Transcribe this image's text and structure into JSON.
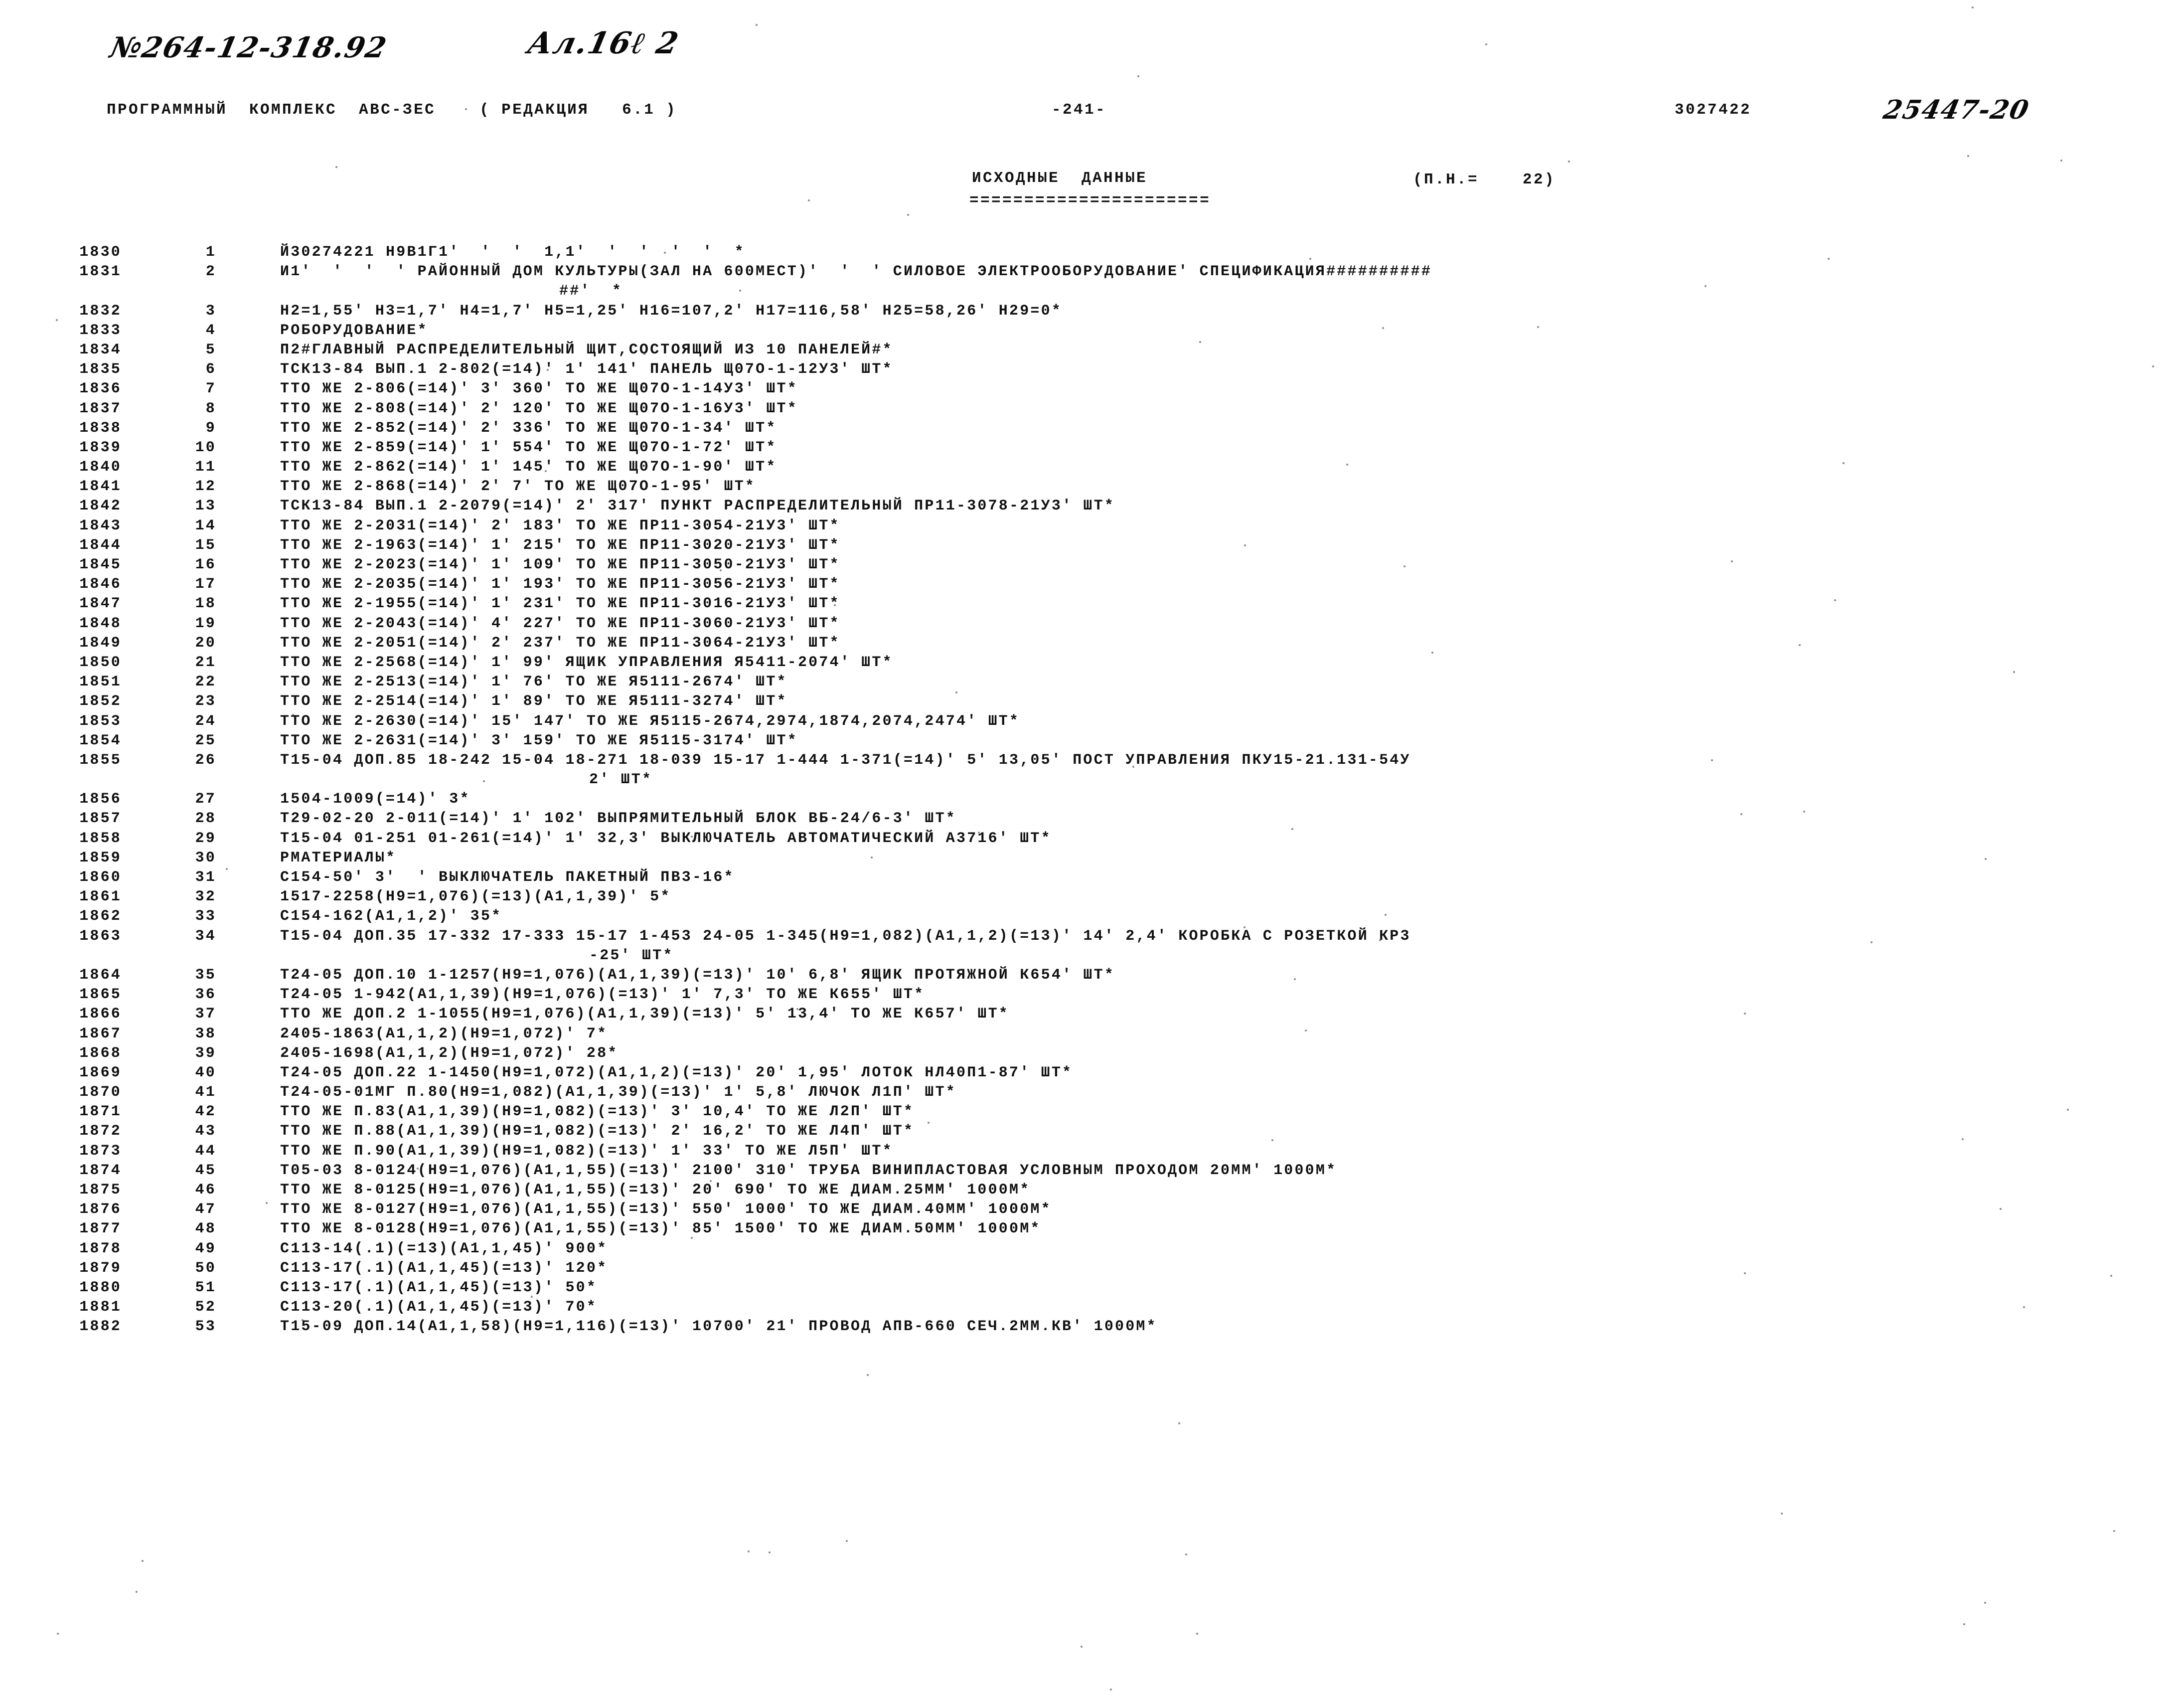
{
  "annotations": {
    "doc_code": "№264-12-318.92",
    "album": "Ал.16ℓ 2",
    "right_number": "25447-20"
  },
  "header": {
    "program_line": "ПРОГРАММНЫЙ  КОМПЛЕКС  АВС-ЗЕС    ( РЕДАКЦИЯ   6.1 )",
    "page_number": "-241-",
    "document_number": "3027422"
  },
  "title": {
    "main": "ИСХОДНЫЕ  ДАННЫЕ",
    "rule": "======================",
    "param": "(П.Н.=    22)"
  },
  "listing": [
    {
      "line": "1830",
      "seq": "1",
      "text": "Й30274221 Н9В1Г1'  '  '  1,1'  '  '  '  '  *"
    },
    {
      "line": "1831",
      "seq": "2",
      "text": "И1'  '  '  ' РАЙОННЫЙ ДОМ КУЛЬТУРЫ(ЗАЛ НА 600МЕСТ)'  '  ' СИЛОВОЕ ЭЛЕКТРООБОРУДОВАНИЕ' СПЕЦИФИКАЦИЯ##########"
    },
    {
      "line": "",
      "seq": "",
      "text": "##'  *",
      "cont": true,
      "indent": 560
    },
    {
      "line": "1832",
      "seq": "3",
      "text": "Н2=1,55' Н3=1,7' Н4=1,7' Н5=1,25' Н16=107,2' Н17=116,58' Н25=58,26' Н29=0*"
    },
    {
      "line": "1833",
      "seq": "4",
      "text": "РОБОРУДОВАНИЕ*"
    },
    {
      "line": "1834",
      "seq": "5",
      "text": "П2#ГЛАВНЫЙ РАСПРЕДЕЛИТЕЛЬНЫЙ ЩИТ,СОСТОЯЩИЙ ИЗ 10 ПАНЕЛЕЙ#*"
    },
    {
      "line": "1835",
      "seq": "6",
      "text": "ТСК13-84 ВЫП.1 2-802(=14)' 1' 141' ПАНЕЛЬ Щ07О-1-12У3' ШТ*"
    },
    {
      "line": "1836",
      "seq": "7",
      "text": "ТТО ЖЕ 2-806(=14)' 3' 360' ТО ЖЕ Щ07О-1-14У3' ШТ*"
    },
    {
      "line": "1837",
      "seq": "8",
      "text": "ТТО ЖЕ 2-808(=14)' 2' 120' ТО ЖЕ Щ07О-1-16У3' ШТ*"
    },
    {
      "line": "1838",
      "seq": "9",
      "text": "ТТО ЖЕ 2-852(=14)' 2' 336' ТО ЖЕ Щ07О-1-34' ШТ*"
    },
    {
      "line": "1839",
      "seq": "10",
      "text": "ТТО ЖЕ 2-859(=14)' 1' 554' ТО ЖЕ Щ07О-1-72' ШТ*"
    },
    {
      "line": "1840",
      "seq": "11",
      "text": "ТТО ЖЕ 2-862(=14)' 1' 145' ТО ЖЕ Щ07О-1-90' ШТ*"
    },
    {
      "line": "1841",
      "seq": "12",
      "text": "ТТО ЖЕ 2-868(=14)' 2' 7' ТО ЖЕ Щ07О-1-95' ШТ*"
    },
    {
      "line": "1842",
      "seq": "13",
      "text": "ТСК13-84 ВЫП.1 2-2079(=14)' 2' 317' ПУНКТ РАСПРЕДЕЛИТЕЛЬНЫЙ ПР11-3078-21У3' ШТ*"
    },
    {
      "line": "1843",
      "seq": "14",
      "text": "ТТО ЖЕ 2-2031(=14)' 2' 183' ТО ЖЕ ПР11-3054-21У3' ШТ*"
    },
    {
      "line": "1844",
      "seq": "15",
      "text": "ТТО ЖЕ 2-1963(=14)' 1' 215' ТО ЖЕ ПР11-3020-21У3' ШТ*"
    },
    {
      "line": "1845",
      "seq": "16",
      "text": "ТТО ЖЕ 2-2023(=14)' 1' 109' ТО ЖЕ ПР11-3050-21У3' ШТ*"
    },
    {
      "line": "1846",
      "seq": "17",
      "text": "ТТО ЖЕ 2-2035(=14)' 1' 193' ТО ЖЕ ПР11-3056-21У3' ШТ*"
    },
    {
      "line": "1847",
      "seq": "18",
      "text": "ТТО ЖЕ 2-1955(=14)' 1' 231' ТО ЖЕ ПР11-3016-21У3' ШТ*"
    },
    {
      "line": "1848",
      "seq": "19",
      "text": "ТТО ЖЕ 2-2043(=14)' 4' 227' ТО ЖЕ ПР11-3060-21У3' ШТ*"
    },
    {
      "line": "1849",
      "seq": "20",
      "text": "ТТО ЖЕ 2-2051(=14)' 2' 237' ТО ЖЕ ПР11-3064-21У3' ШТ*"
    },
    {
      "line": "1850",
      "seq": "21",
      "text": "ТТО ЖЕ 2-2568(=14)' 1' 99' ЯЩИК УПРАВЛЕНИЯ Я5411-2074' ШТ*"
    },
    {
      "line": "1851",
      "seq": "22",
      "text": "ТТО ЖЕ 2-2513(=14)' 1' 76' ТО ЖЕ Я5111-2674' ШТ*"
    },
    {
      "line": "1852",
      "seq": "23",
      "text": "ТТО ЖЕ 2-2514(=14)' 1' 89' ТО ЖЕ Я5111-3274' ШТ*"
    },
    {
      "line": "1853",
      "seq": "24",
      "text": "ТТО ЖЕ 2-2630(=14)' 15' 147' ТО ЖЕ Я5115-2674,2974,1874,2074,2474' ШТ*"
    },
    {
      "line": "1854",
      "seq": "25",
      "text": "ТТО ЖЕ 2-2631(=14)' 3' 159' ТО ЖЕ Я5115-3174' ШТ*"
    },
    {
      "line": "1855",
      "seq": "26",
      "text": "Т15-04 ДОП.85 18-242 15-04 18-271 18-039 15-17 1-444 1-371(=14)' 5' 13,05' ПОСТ УПРАВЛЕНИЯ ПКУ15-21.131-54У"
    },
    {
      "line": "",
      "seq": "",
      "text": "2' ШТ*",
      "cont": true,
      "indent": 620
    },
    {
      "line": "1856",
      "seq": "27",
      "text": "1504-1009(=14)' 3*"
    },
    {
      "line": "1857",
      "seq": "28",
      "text": "Т29-02-20 2-011(=14)' 1' 102' ВЫПРЯМИТЕЛЬНЫЙ БЛОК ВБ-24/6-3' ШТ*"
    },
    {
      "line": "1858",
      "seq": "29",
      "text": "Т15-04 01-251 01-261(=14)' 1' 32,3' ВЫКЛЮЧАТЕЛЬ АВТОМАТИЧЕСКИЙ А3716' ШТ*"
    },
    {
      "line": "1859",
      "seq": "30",
      "text": "РМАТЕРИАЛЫ*"
    },
    {
      "line": "1860",
      "seq": "31",
      "text": "С154-50' 3'  ' ВЫКЛЮЧАТЕЛЬ ПАКЕТНЫЙ ПВ3-16*"
    },
    {
      "line": "1861",
      "seq": "32",
      "text": "1517-2258(Н9=1,076)(=13)(А1,1,39)' 5*"
    },
    {
      "line": "1862",
      "seq": "33",
      "text": "С154-162(А1,1,2)' 35*"
    },
    {
      "line": "1863",
      "seq": "34",
      "text": "Т15-04 ДОП.35 17-332 17-333 15-17 1-453 24-05 1-345(Н9=1,082)(А1,1,2)(=13)' 14' 2,4' КОРОБКА С РОЗЕТКОЙ КР3"
    },
    {
      "line": "",
      "seq": "",
      "text": "-25' ШТ*",
      "cont": true,
      "indent": 620
    },
    {
      "line": "1864",
      "seq": "35",
      "text": "Т24-05 ДОП.10 1-1257(Н9=1,076)(А1,1,39)(=13)' 10' 6,8' ЯЩИК ПРОТЯЖНОЙ К654' ШТ*"
    },
    {
      "line": "1865",
      "seq": "36",
      "text": "Т24-05 1-942(А1,1,39)(Н9=1,076)(=13)' 1' 7,3' ТО ЖЕ К655' ШТ*"
    },
    {
      "line": "1866",
      "seq": "37",
      "text": "ТТО ЖЕ ДОП.2 1-1055(Н9=1,076)(А1,1,39)(=13)' 5' 13,4' ТО ЖЕ К657' ШТ*"
    },
    {
      "line": "1867",
      "seq": "38",
      "text": "2405-1863(А1,1,2)(Н9=1,072)' 7*"
    },
    {
      "line": "1868",
      "seq": "39",
      "text": "2405-1698(А1,1,2)(Н9=1,072)' 28*"
    },
    {
      "line": "1869",
      "seq": "40",
      "text": "Т24-05 ДОП.22 1-1450(Н9=1,072)(А1,1,2)(=13)' 20' 1,95' ЛОТОК НЛ40П1-87' ШТ*"
    },
    {
      "line": "1870",
      "seq": "41",
      "text": "Т24-05-01МГ П.80(Н9=1,082)(А1,1,39)(=13)' 1' 5,8' ЛЮЧОК Л1П' ШТ*"
    },
    {
      "line": "1871",
      "seq": "42",
      "text": "ТТО ЖЕ П.83(А1,1,39)(Н9=1,082)(=13)' 3' 10,4' ТО ЖЕ Л2П' ШТ*"
    },
    {
      "line": "1872",
      "seq": "43",
      "text": "ТТО ЖЕ П.88(А1,1,39)(Н9=1,082)(=13)' 2' 16,2' ТО ЖЕ Л4П' ШТ*"
    },
    {
      "line": "1873",
      "seq": "44",
      "text": "ТТО ЖЕ П.90(А1,1,39)(Н9=1,082)(=13)' 1' 33' ТО ЖЕ Л5П' ШТ*"
    },
    {
      "line": "1874",
      "seq": "45",
      "text": "Т05-03 8-0124(Н9=1,076)(А1,1,55)(=13)' 2100' 310' ТРУБА ВИНИПЛАСТОВАЯ УСЛОВНЫМ ПРОХОДОМ 20ММ' 1000М*"
    },
    {
      "line": "1875",
      "seq": "46",
      "text": "ТТО ЖЕ 8-0125(Н9=1,076)(А1,1,55)(=13)' 20' 690' ТО ЖЕ ДИАМ.25ММ' 1000М*"
    },
    {
      "line": "1876",
      "seq": "47",
      "text": "ТТО ЖЕ 8-0127(Н9=1,076)(А1,1,55)(=13)' 550' 1000' ТО ЖЕ ДИАМ.40ММ' 1000М*"
    },
    {
      "line": "1877",
      "seq": "48",
      "text": "ТТО ЖЕ 8-0128(Н9=1,076)(А1,1,55)(=13)' 85' 1500' ТО ЖЕ ДИАМ.50ММ' 1000М*"
    },
    {
      "line": "1878",
      "seq": "49",
      "text": "С113-14(.1)(=13)(А1,1,45)' 900*"
    },
    {
      "line": "1879",
      "seq": "50",
      "text": "С113-17(.1)(А1,1,45)(=13)' 120*"
    },
    {
      "line": "1880",
      "seq": "51",
      "text": "С113-17(.1)(А1,1,45)(=13)' 50*"
    },
    {
      "line": "1881",
      "seq": "52",
      "text": "С113-20(.1)(А1,1,45)(=13)' 70*"
    },
    {
      "line": "1882",
      "seq": "53",
      "text": "Т15-09 ДОП.14(А1,1,58)(Н9=1,116)(=13)' 10700' 21' ПРОВОД АПВ-660 СЕЧ.2ММ.КВ' 1000М*"
    }
  ]
}
